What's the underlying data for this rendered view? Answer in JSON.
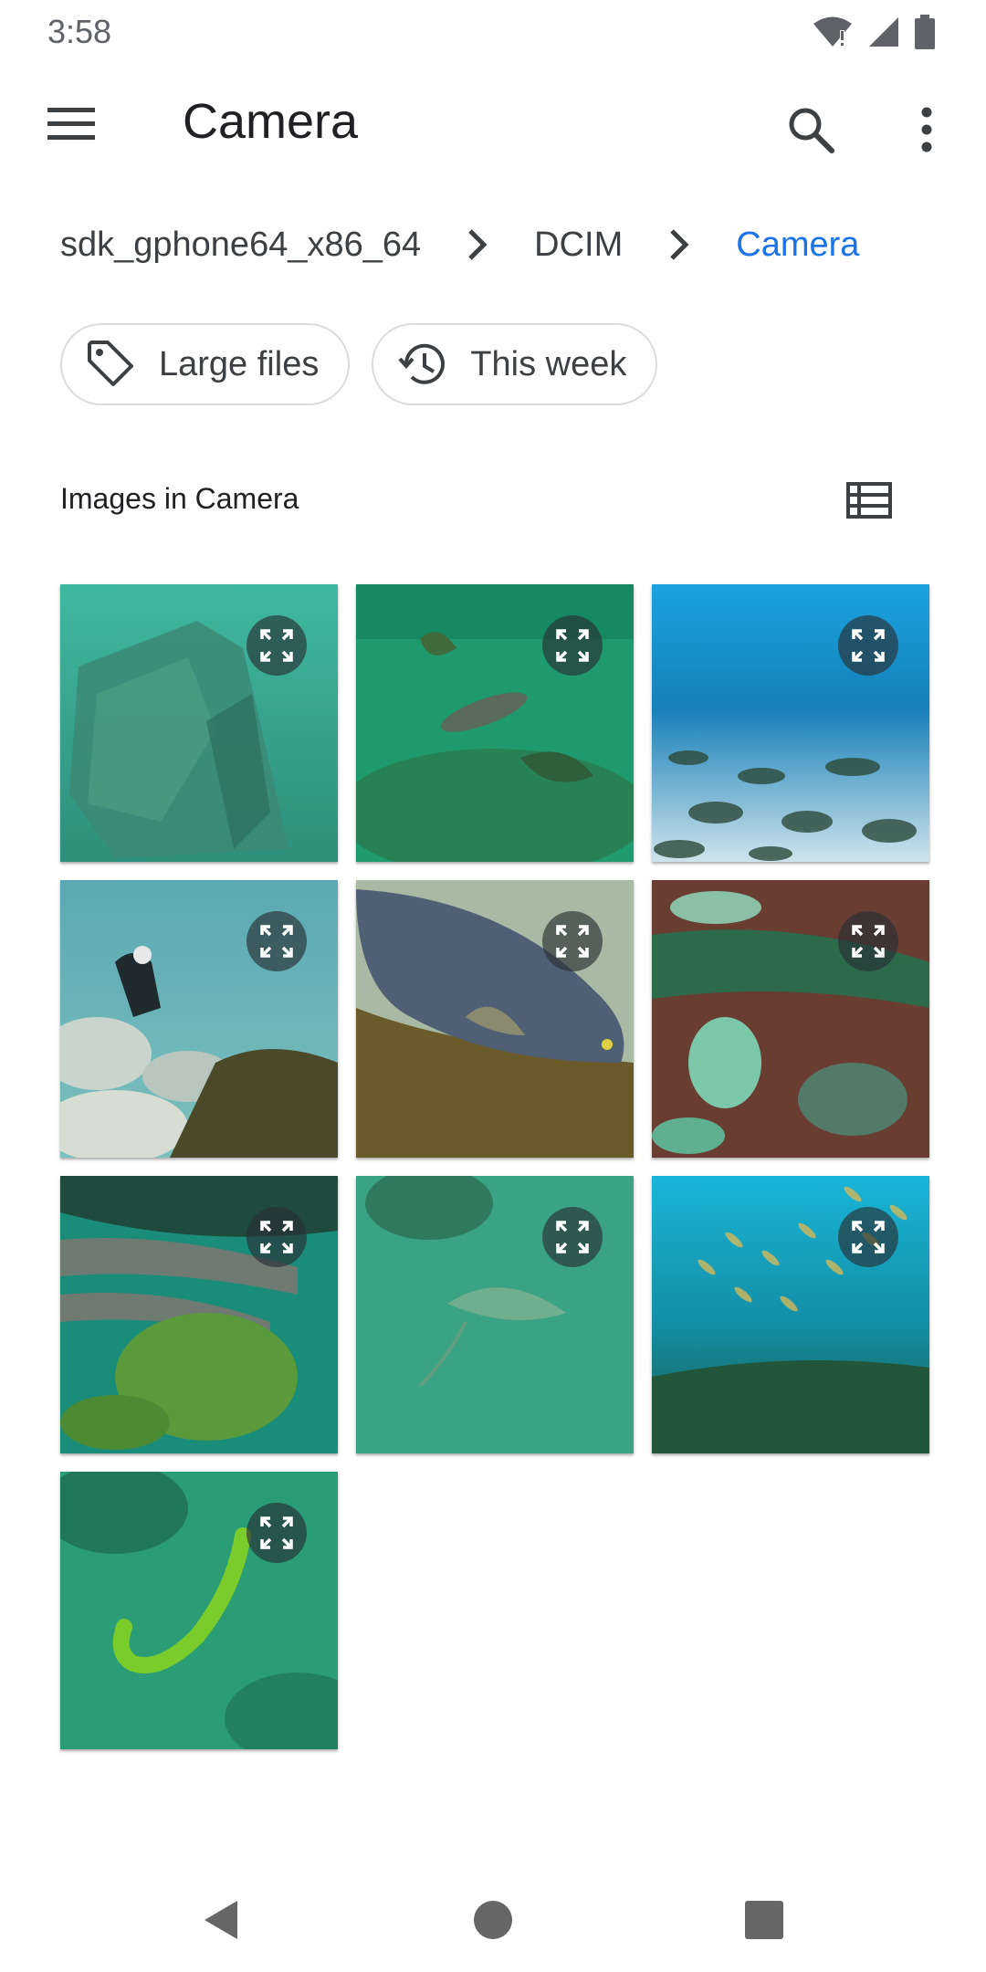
{
  "status_bar": {
    "time": "3:58"
  },
  "app_bar": {
    "title": "Camera",
    "icons": [
      "menu-icon",
      "search-icon",
      "more-vert-icon"
    ]
  },
  "breadcrumb": {
    "items": [
      {
        "label": "sdk_gphone64_x86_64",
        "active": false
      },
      {
        "label": "DCIM",
        "active": false
      },
      {
        "label": "Camera",
        "active": true
      }
    ]
  },
  "chips": [
    {
      "label": "Large files",
      "icon": "tag-icon"
    },
    {
      "label": "This week",
      "icon": "history-icon"
    }
  ],
  "section": {
    "title": "Images in Camera",
    "view_icon": "list-view-icon"
  },
  "images": [
    {
      "name": "image-1",
      "theme": "green-cloth"
    },
    {
      "name": "image-2",
      "theme": "green-fish"
    },
    {
      "name": "image-3",
      "theme": "blue-seafloor"
    },
    {
      "name": "image-4",
      "theme": "diver"
    },
    {
      "name": "image-5",
      "theme": "blue-fish"
    },
    {
      "name": "image-6",
      "theme": "rock-lichen"
    },
    {
      "name": "image-7",
      "theme": "sponge"
    },
    {
      "name": "image-8",
      "theme": "stingray"
    },
    {
      "name": "image-9",
      "theme": "school-of-fish"
    },
    {
      "name": "image-10",
      "theme": "green-eel"
    }
  ],
  "colors": {
    "accent": "#1a73e8",
    "chip_border": "#dadce0",
    "text": "#202124"
  }
}
